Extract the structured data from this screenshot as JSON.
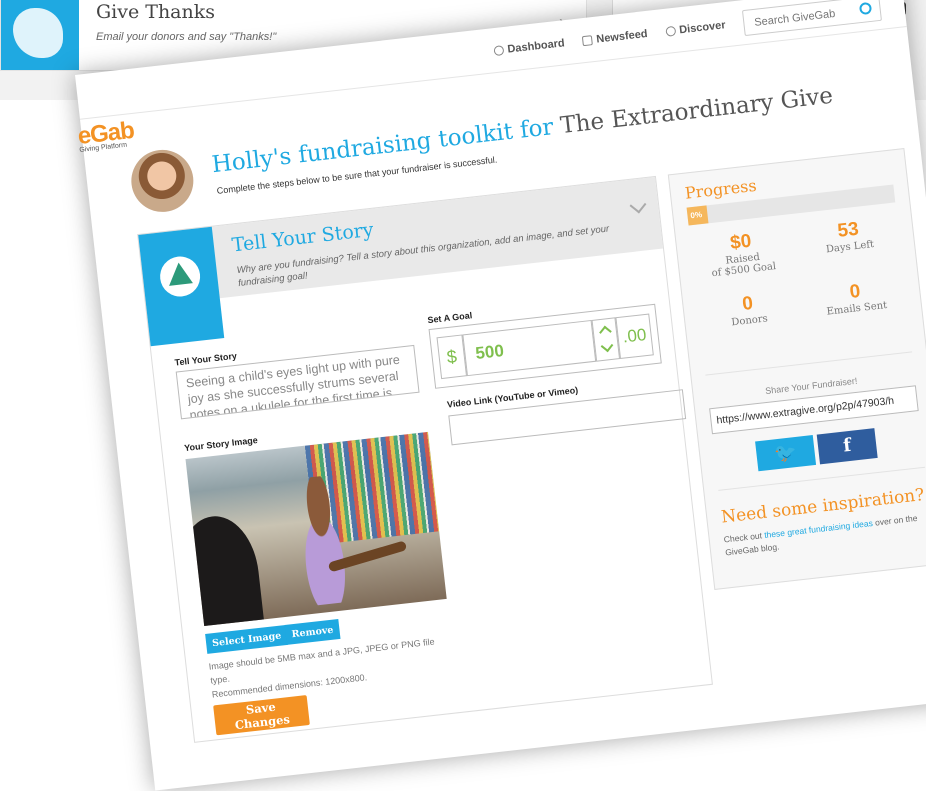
{
  "background_card": {
    "title": "Give Thanks",
    "subtitle": "Email your donors and say \"Thanks!\""
  },
  "nav": {
    "dashboard": "Dashboard",
    "newsfeed": "Newsfeed",
    "discover": "Discover",
    "search_placeholder": "Search GiveGab"
  },
  "logo": {
    "word": "eGab",
    "tagline": "Giving Platform"
  },
  "header": {
    "title_prefix": "Holly's fundraising toolkit for",
    "campaign": "The Extraordinary Give",
    "subtitle": "Complete the steps below to be sure that your fundraiser is successful."
  },
  "story_step": {
    "title": "Tell Your Story",
    "description": "Why are you fundraising? Tell a story about this organization, add an image, and set your fundraising goal!",
    "story_label": "Tell Your Story",
    "story_text": "Seeing a child's eyes light up with pure joy as she successfully strums several notes on a ukulele for the first time is",
    "image_label": "Your Story Image",
    "select_image": "Select Image",
    "remove": "Remove",
    "image_note_1": "Image should be 5MB max and a JPG, JPEG or PNG file type.",
    "image_note_2": "Recommended dimensions: 1200x800.",
    "goal_label": "Set A Goal",
    "goal_currency": "$",
    "goal_value": "500",
    "goal_cents": ".00",
    "video_label": "Video Link (YouTube or Vimeo)",
    "save": "Save Changes"
  },
  "progress": {
    "title": "Progress",
    "percent_label": "0%",
    "percent": 0,
    "raised_value": "$0",
    "raised_caption_1": "Raised",
    "raised_caption_2": "of $500 Goal",
    "days_value": "53",
    "days_caption": "Days Left",
    "donors_value": "0",
    "donors_caption": "Donors",
    "emails_value": "0",
    "emails_caption": "Emails Sent",
    "share_label": "Share Your Fundraiser!",
    "share_url": "https://www.extragive.org/p2p/47903/h",
    "twitter_glyph": "🐦",
    "facebook_glyph": "f",
    "inspiration_title": "Need some inspiration?",
    "inspiration_pre": "Check out",
    "inspiration_link": "these great fundraising ideas",
    "inspiration_post": "over on the GiveGab blog."
  },
  "colors": {
    "accent_blue": "#1fa9e1",
    "accent_orange": "#f39224",
    "goal_green": "#7fbf4d"
  }
}
